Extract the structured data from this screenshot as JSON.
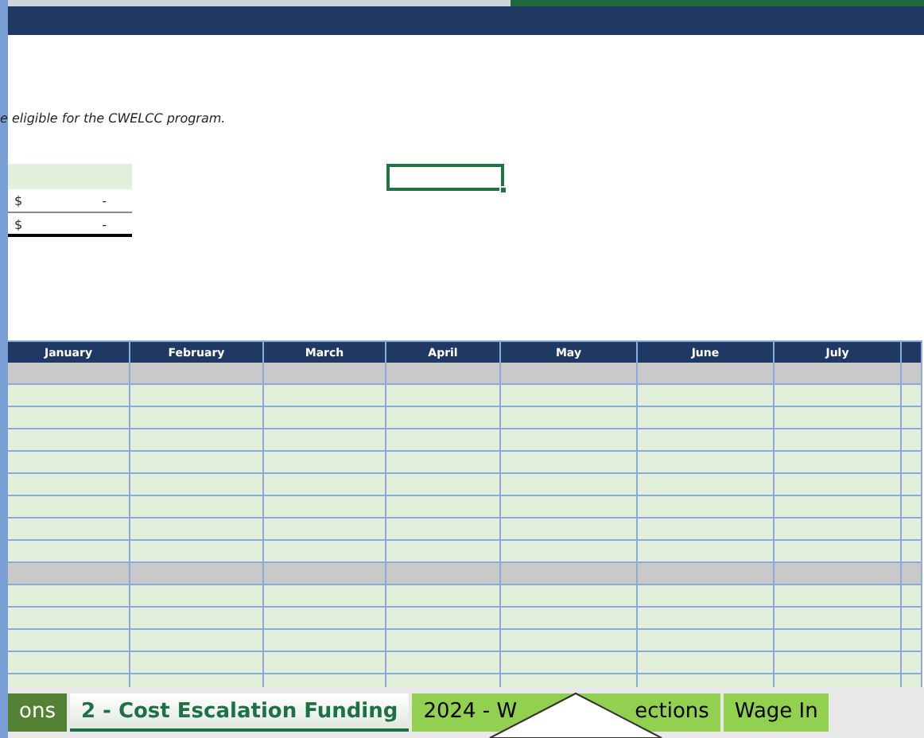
{
  "note": "e eligible for the CWELCC program.",
  "summary_rows": [
    {
      "currency": "$",
      "value": "-",
      "kind": "subtotal"
    },
    {
      "currency": "$",
      "value": "-",
      "kind": "total"
    }
  ],
  "table": {
    "columns": [
      "January",
      "February",
      "March",
      "April",
      "May",
      "June",
      "July",
      ""
    ],
    "rows": [
      {
        "kind": "group"
      },
      {
        "kind": "data"
      },
      {
        "kind": "data"
      },
      {
        "kind": "data"
      },
      {
        "kind": "data"
      },
      {
        "kind": "data"
      },
      {
        "kind": "data"
      },
      {
        "kind": "data"
      },
      {
        "kind": "data"
      },
      {
        "kind": "group"
      },
      {
        "kind": "data"
      },
      {
        "kind": "data"
      },
      {
        "kind": "data"
      },
      {
        "kind": "data"
      },
      {
        "kind": "data"
      }
    ]
  },
  "sheet_tabs": [
    {
      "label": "ons",
      "kind": "dark",
      "selected": false
    },
    {
      "label": "2 - Cost Escalation Funding",
      "kind": "plain",
      "selected": true
    },
    {
      "label": "2024 - W",
      "label_after": "ections",
      "kind": "light",
      "selected": false
    },
    {
      "label": "Wage In",
      "kind": "light",
      "selected": false
    }
  ]
}
